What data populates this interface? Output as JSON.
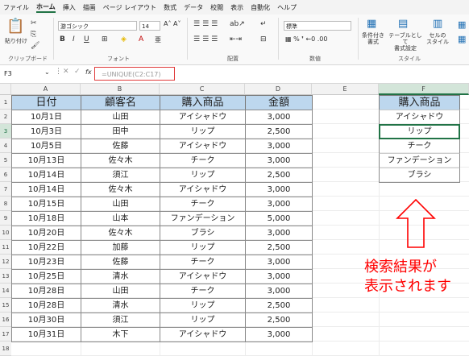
{
  "menu": [
    "ファイル",
    "ホーム",
    "挿入",
    "描画",
    "ページ レイアウト",
    "数式",
    "データ",
    "校閲",
    "表示",
    "自動化",
    "ヘルプ"
  ],
  "ribbon": {
    "paste": "貼り付け",
    "font_name": "游ゴシック",
    "font_size": "14",
    "number_format": "標準",
    "cond_format": "条件付き\n書式",
    "table_format": "テーブルとして\n書式設定",
    "cell_style": "セルの\nスタイル",
    "groups": [
      "クリップボード",
      "フォント",
      "配置",
      "数値",
      "スタイル"
    ]
  },
  "formula_bar": {
    "name_box": "F3",
    "fx": "fx",
    "formula": "=UNIQUE(C2:C17)"
  },
  "columns": [
    "A",
    "B",
    "C",
    "D",
    "E",
    "F"
  ],
  "rows": [
    "1",
    "2",
    "3",
    "4",
    "5",
    "6",
    "7",
    "8",
    "9",
    "10",
    "11",
    "12",
    "13",
    "14",
    "15",
    "16",
    "17",
    "18"
  ],
  "table": {
    "headers": [
      "日付",
      "顧客名",
      "購入商品",
      "金額"
    ],
    "rows": [
      [
        "10月1日",
        "山田",
        "アイシャドウ",
        "3,000"
      ],
      [
        "10月3日",
        "田中",
        "リップ",
        "2,500"
      ],
      [
        "10月5日",
        "佐藤",
        "アイシャドウ",
        "3,000"
      ],
      [
        "10月13日",
        "佐々木",
        "チーク",
        "3,000"
      ],
      [
        "10月14日",
        "須江",
        "リップ",
        "2,500"
      ],
      [
        "10月14日",
        "佐々木",
        "アイシャドウ",
        "3,000"
      ],
      [
        "10月15日",
        "山田",
        "チーク",
        "3,000"
      ],
      [
        "10月18日",
        "山本",
        "ファンデーション",
        "5,000"
      ],
      [
        "10月20日",
        "佐々木",
        "ブラシ",
        "3,000"
      ],
      [
        "10月22日",
        "加藤",
        "リップ",
        "2,500"
      ],
      [
        "10月23日",
        "佐藤",
        "チーク",
        "3,000"
      ],
      [
        "10月25日",
        "清水",
        "アイシャドウ",
        "3,000"
      ],
      [
        "10月28日",
        "山田",
        "チーク",
        "3,000"
      ],
      [
        "10月28日",
        "清水",
        "リップ",
        "2,500"
      ],
      [
        "10月30日",
        "須江",
        "リップ",
        "2,500"
      ],
      [
        "10月31日",
        "木下",
        "アイシャドウ",
        "3,000"
      ]
    ]
  },
  "unique": {
    "header": "購入商品",
    "items": [
      "アイシャドウ",
      "リップ",
      "チーク",
      "ファンデーション",
      "ブラシ"
    ]
  },
  "annotation": {
    "line1": "検索結果が",
    "line2": "表示されます"
  },
  "colors": {
    "header_fill": "#bdd7ee",
    "active_cell": "#217346",
    "annotation": "#ff0000"
  }
}
